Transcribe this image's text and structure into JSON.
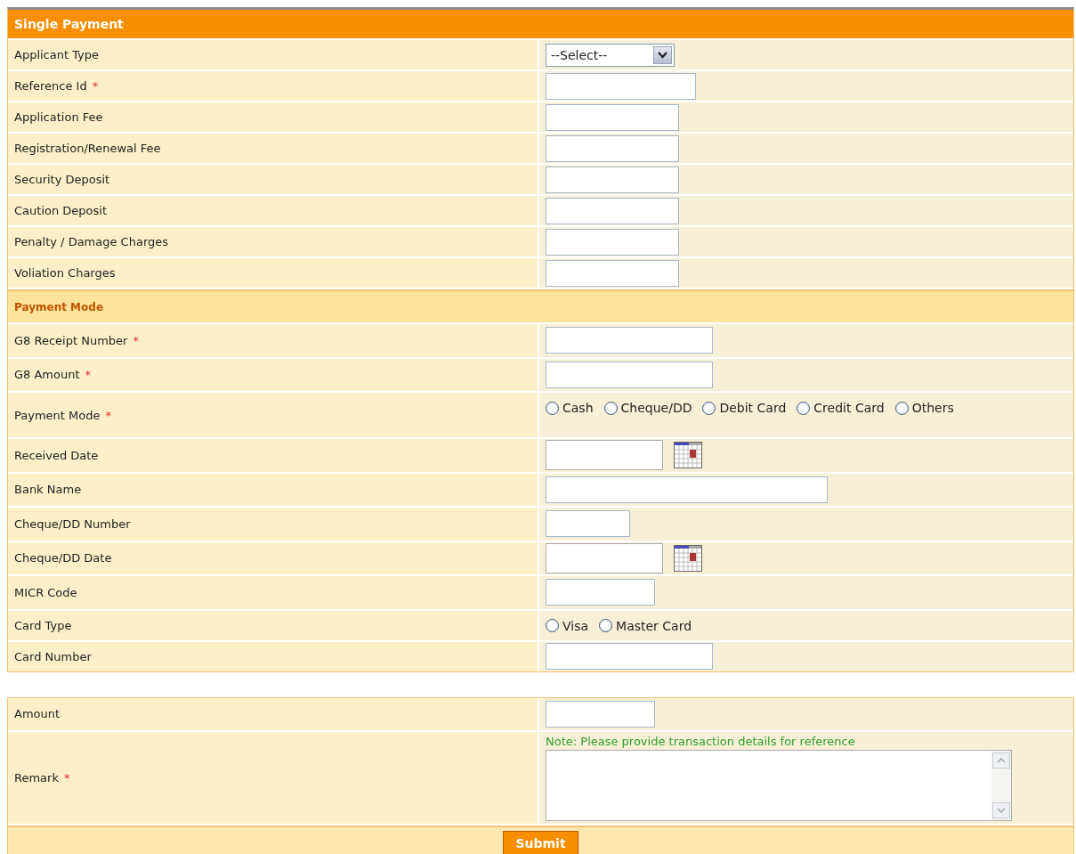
{
  "header": {
    "title": "Single Payment"
  },
  "main_rows": [
    {
      "label": "Applicant Type",
      "kind": "select",
      "value": "--Select--"
    },
    {
      "label": "Reference Id",
      "mark": "*",
      "kind": "text"
    },
    {
      "label": "Application Fee",
      "kind": "text"
    },
    {
      "label": "Registration/Renewal Fee",
      "kind": "text"
    },
    {
      "label": "Security Deposit",
      "kind": "text"
    },
    {
      "label": "Caution Deposit",
      "kind": "text"
    },
    {
      "label": "Penalty / Damage Charges",
      "kind": "text"
    },
    {
      "label": "Voliation Charges",
      "kind": "text"
    }
  ],
  "payment_section": {
    "title": "Payment Mode",
    "rows": [
      {
        "label": "G8 Receipt Number",
        "mark": "*",
        "kind": "text"
      },
      {
        "label": "G8 Amount",
        "mark": "*",
        "kind": "text"
      },
      {
        "label": "Payment Mode",
        "mark": "*",
        "kind": "radio",
        "options": [
          {
            "label": "Cash",
            "selected": false
          },
          {
            "label": "Cheque/DD",
            "selected": false
          },
          {
            "label": "Debit Card",
            "selected": false
          },
          {
            "label": "Credit Card",
            "selected": false
          },
          {
            "label": "Others",
            "selected": false
          }
        ]
      },
      {
        "label": "Received Date",
        "kind": "date"
      },
      {
        "label": "Bank Name",
        "kind": "text"
      },
      {
        "label": "Cheque/DD Number",
        "kind": "text"
      },
      {
        "label": "Cheque/DD Date",
        "kind": "date"
      },
      {
        "label": "MICR Code",
        "kind": "text"
      },
      {
        "label": "Card Type",
        "kind": "radio",
        "options": [
          {
            "label": "Visa",
            "selected": false
          },
          {
            "label": "Master Card",
            "selected": false
          }
        ]
      },
      {
        "label": "Card Number",
        "kind": "text"
      }
    ]
  },
  "bottom_rows": [
    {
      "label": "Amount",
      "kind": "text"
    },
    {
      "label": "Remark",
      "mark": "*",
      "kind": "textarea",
      "note": "Note: Please provide transaction details for reference"
    }
  ],
  "submit": {
    "label": "Submit"
  }
}
